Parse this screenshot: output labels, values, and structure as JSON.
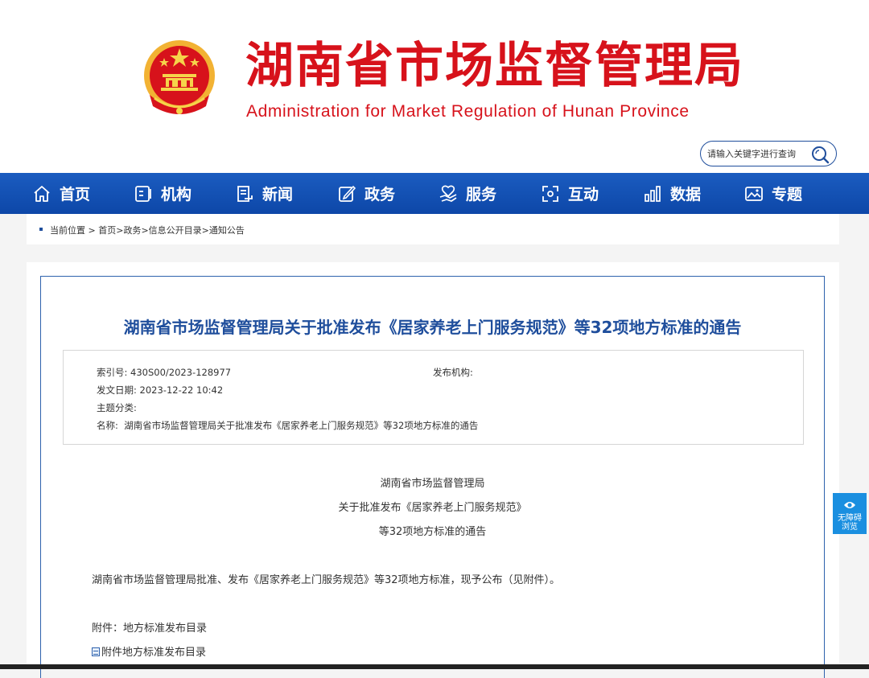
{
  "header": {
    "title": "湖南省市场监督管理局",
    "subtitle": "Administration for Market Regulation of Hunan Province",
    "emblem_icon": "national-emblem-icon",
    "brand_color": "#d7121b"
  },
  "search": {
    "placeholder": "请输入关键字进行查询",
    "icon": "search-icon"
  },
  "nav": {
    "background": "#0f4fb0",
    "items": [
      {
        "label": "首页",
        "icon": "home-icon"
      },
      {
        "label": "机构",
        "icon": "org-icon"
      },
      {
        "label": "新闻",
        "icon": "news-icon"
      },
      {
        "label": "政务",
        "icon": "edit-icon"
      },
      {
        "label": "服务",
        "icon": "service-icon"
      },
      {
        "label": "互动",
        "icon": "interact-icon"
      },
      {
        "label": "数据",
        "icon": "bar-chart-icon"
      },
      {
        "label": "专题",
        "icon": "image-icon"
      }
    ]
  },
  "breadcrumb": {
    "prefix": "当前位置 > ",
    "items": [
      "首页",
      "政务",
      "信息公开目录",
      "通知公告"
    ],
    "separator": ">"
  },
  "article": {
    "title": "湖南省市场监督管理局关于批准发布《居家养老上门服务规范》等32项地方标准的通告",
    "title_color": "#1f4e9c",
    "meta": {
      "index_label": "索引号:",
      "index_value": "430S00/2023-128977",
      "publisher_label": "发布机构:",
      "publisher_value": "",
      "date_label": "发文日期:",
      "date_value": "2023-12-22 10:42",
      "topic_label": "主题分类:",
      "topic_value": "",
      "name_label": "名称:",
      "name_value": "湖南省市场监督管理局关于批准发布《居家养老上门服务规范》等32项地方标准的通告"
    },
    "heading_lines": [
      "湖南省市场监督管理局",
      "关于批准发布《居家养老上门服务规范》",
      "等32项地方标准的通告"
    ],
    "body": "湖南省市场监督管理局批准、发布《居家养老上门服务规范》等32项地方标准，现予公布（见附件）。",
    "attachment_label": "附件：地方标准发布目录",
    "attachment_link": "附件地方标准发布目录",
    "attachment_icon": "document-icon"
  },
  "accessibility": {
    "line1": "无障碍",
    "line2": "浏览",
    "icon": "eye-icon"
  }
}
